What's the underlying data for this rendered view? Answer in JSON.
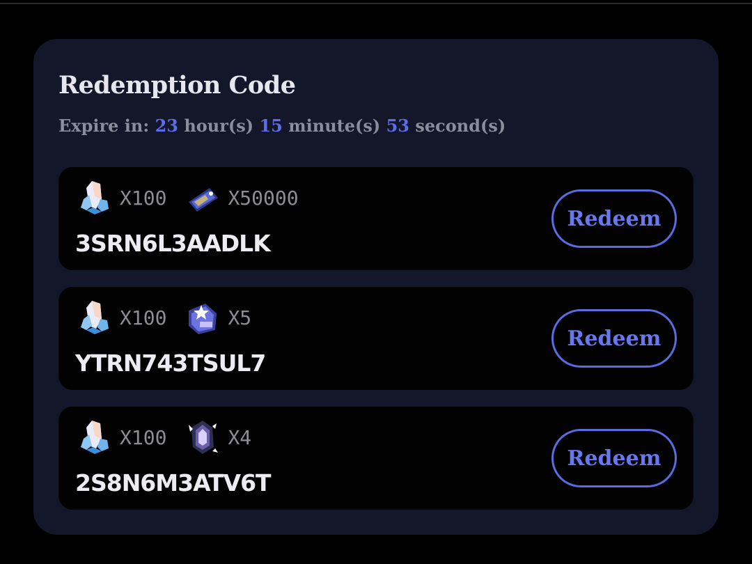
{
  "panel": {
    "title": "Redemption Code",
    "expire": {
      "label": "Expire in:",
      "hours": "23",
      "hours_unit": "hour(s)",
      "minutes": "15",
      "minutes_unit": "minute(s)",
      "seconds": "53",
      "seconds_unit": "second(s)"
    }
  },
  "codes": [
    {
      "code": "3SRN6L3AADLK",
      "redeem_label": "Redeem",
      "rewards": [
        {
          "icon": "crystal-icon",
          "qty": "X100"
        },
        {
          "icon": "ticket-card-icon",
          "qty": "X50000"
        }
      ]
    },
    {
      "code": "YTRN743TSUL7",
      "redeem_label": "Redeem",
      "rewards": [
        {
          "icon": "crystal-icon",
          "qty": "X100"
        },
        {
          "icon": "star-pass-icon",
          "qty": "X5"
        }
      ]
    },
    {
      "code": "2S8N6M3ATV6T",
      "redeem_label": "Redeem",
      "rewards": [
        {
          "icon": "crystal-icon",
          "qty": "X100"
        },
        {
          "icon": "lantern-item-icon",
          "qty": "X4"
        }
      ]
    }
  ],
  "colors": {
    "background": "#000000",
    "panel": "#131729",
    "card": "#020203",
    "accent": "#5a6ee8",
    "muted_text": "#8a8d9c",
    "code_text": "#ececf2"
  }
}
